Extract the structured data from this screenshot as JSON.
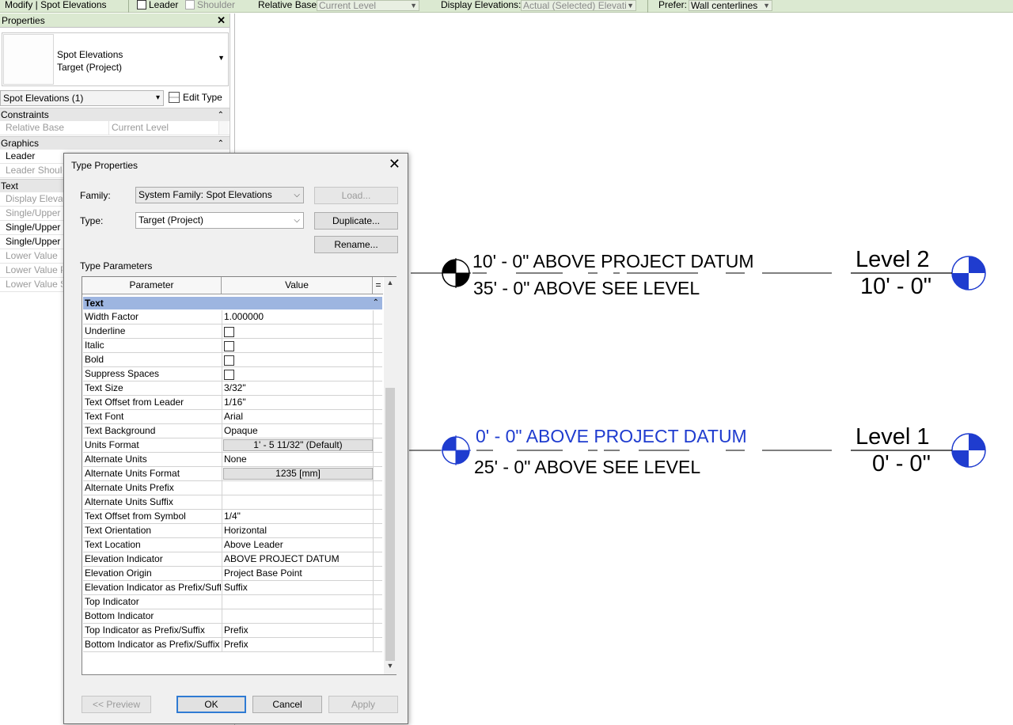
{
  "options_bar": {
    "context_title": "Modify | Spot Elevations",
    "leader_label": "Leader",
    "shoulder_label": "Shoulder",
    "relative_base_label": "Relative Base:",
    "relative_base_value": "Current Level",
    "display_elevations_label": "Display Elevations:",
    "display_elevations_value": "Actual (Selected) Elevati",
    "prefer_label": "Prefer:",
    "prefer_value": "Wall centerlines"
  },
  "properties": {
    "header": "Properties",
    "close_glyph": "✕",
    "type_name_line1": "Spot Elevations",
    "type_name_line2": "Target (Project)",
    "instance_selector": "Spot Elevations (1)",
    "edit_type_label": "Edit Type",
    "sections": [
      {
        "name": "Constraints",
        "rows": [
          {
            "name": "Relative Base",
            "value": "Current Level",
            "disabled": true
          }
        ]
      },
      {
        "name": "Graphics",
        "rows": [
          {
            "name": "Leader",
            "value": "",
            "disabled": false
          },
          {
            "name": "Leader Shoulder",
            "value": "",
            "disabled": true
          }
        ]
      },
      {
        "name": "Text",
        "rows": [
          {
            "name": "Display Elevations",
            "disabled": true
          },
          {
            "name": "Single/Upper Value Prefix",
            "disabled": true
          },
          {
            "name": "Single/Upper Value Suffix",
            "disabled": false
          },
          {
            "name": "Single/Upper Value",
            "disabled": false
          },
          {
            "name": "Lower Value",
            "disabled": true
          },
          {
            "name": "Lower Value Prefix",
            "disabled": true
          },
          {
            "name": "Lower Value Suffix",
            "disabled": true
          }
        ]
      }
    ]
  },
  "drawing": {
    "spot_upper": {
      "line1": "10' - 0\" ABOVE PROJECT DATUM",
      "line2": "35' - 0\" ABOVE SEE LEVEL"
    },
    "spot_lower": {
      "line1": "0' - 0\" ABOVE PROJECT DATUM",
      "line2": "25' - 0\" ABOVE SEE LEVEL"
    },
    "level2": {
      "name": "Level 2",
      "elevation": "10' - 0\""
    },
    "level1": {
      "name": "Level 1",
      "elevation": "0' - 0\""
    },
    "colors": {
      "selected_text": "#1f3ccf",
      "level_head": "#1f3ccf"
    }
  },
  "dialog": {
    "title": "Type Properties",
    "close_glyph": "✕",
    "family_label": "Family:",
    "family_value": "System Family: Spot Elevations",
    "type_label": "Type:",
    "type_value": "Target (Project)",
    "load_label": "Load...",
    "duplicate_label": "Duplicate...",
    "rename_label": "Rename...",
    "type_parameters_label": "Type Parameters",
    "col_parameter": "Parameter",
    "col_value": "Value",
    "col_eq": "=",
    "category": "Text",
    "params": [
      {
        "name": "Width Factor",
        "value": "1.000000",
        "kind": "text"
      },
      {
        "name": "Underline",
        "value": "",
        "kind": "check"
      },
      {
        "name": "Italic",
        "value": "",
        "kind": "check"
      },
      {
        "name": "Bold",
        "value": "",
        "kind": "check"
      },
      {
        "name": "Suppress Spaces",
        "value": "",
        "kind": "check"
      },
      {
        "name": "Text Size",
        "value": "3/32\"",
        "kind": "text"
      },
      {
        "name": "Text Offset from Leader",
        "value": "1/16\"",
        "kind": "text"
      },
      {
        "name": "Text Font",
        "value": "Arial",
        "kind": "text"
      },
      {
        "name": "Text Background",
        "value": "Opaque",
        "kind": "text"
      },
      {
        "name": "Units Format",
        "value": "1' - 5 11/32\" (Default)",
        "kind": "button"
      },
      {
        "name": "Alternate Units",
        "value": "None",
        "kind": "text"
      },
      {
        "name": "Alternate Units Format",
        "value": "1235 [mm]",
        "kind": "button"
      },
      {
        "name": "Alternate Units Prefix",
        "value": "",
        "kind": "text"
      },
      {
        "name": "Alternate Units Suffix",
        "value": "",
        "kind": "text"
      },
      {
        "name": "Text Offset from Symbol",
        "value": "1/4\"",
        "kind": "text"
      },
      {
        "name": "Text Orientation",
        "value": "Horizontal",
        "kind": "text"
      },
      {
        "name": "Text Location",
        "value": "Above Leader",
        "kind": "text"
      },
      {
        "name": "Elevation Indicator",
        "value": "ABOVE PROJECT DATUM",
        "kind": "text"
      },
      {
        "name": "Elevation Origin",
        "value": "Project Base Point",
        "kind": "text"
      },
      {
        "name": "Elevation Indicator as Prefix/Suffix",
        "value": "Suffix",
        "kind": "text"
      },
      {
        "name": "Top Indicator",
        "value": "",
        "kind": "text"
      },
      {
        "name": "Bottom Indicator",
        "value": "",
        "kind": "text"
      },
      {
        "name": "Top Indicator as Prefix/Suffix",
        "value": "Prefix",
        "kind": "text"
      },
      {
        "name": "Bottom Indicator as Prefix/Suffix",
        "value": "Prefix",
        "kind": "text"
      }
    ],
    "preview_label": "<< Preview",
    "ok_label": "OK",
    "cancel_label": "Cancel",
    "apply_label": "Apply"
  }
}
